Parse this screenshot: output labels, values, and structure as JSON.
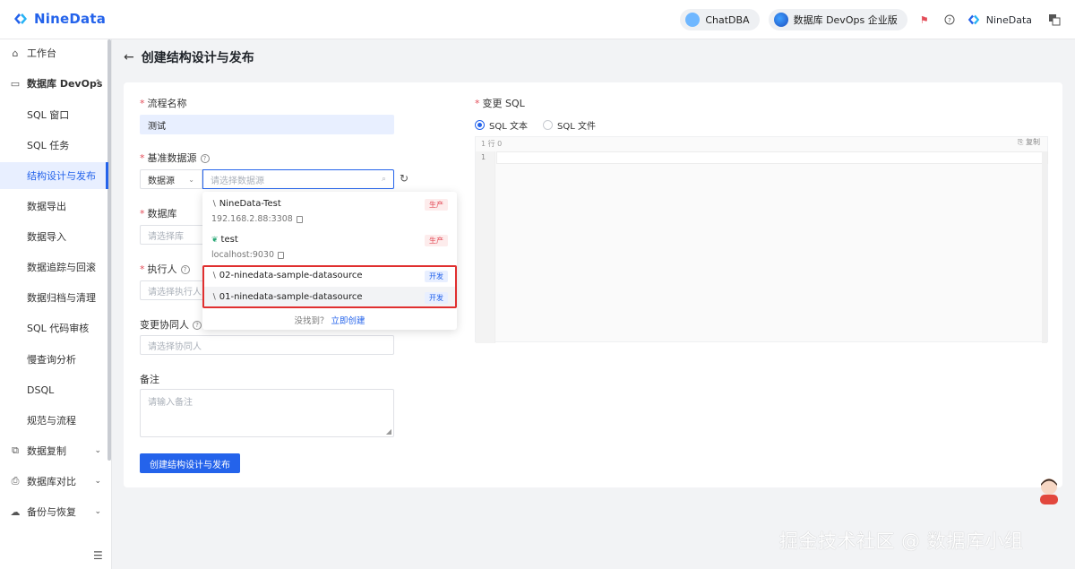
{
  "app": {
    "logo_text": "NineData",
    "chatdba_label": "ChatDBA",
    "edition_label": "数据库 DevOps 企业版",
    "user_name": "NineData"
  },
  "sidebar": {
    "items": [
      {
        "label": "工作台",
        "icon": "home-icon"
      },
      {
        "label": "数据库 DevOps",
        "icon": "monitor-icon",
        "expanded": true
      },
      {
        "label": "SQL 窗口"
      },
      {
        "label": "SQL 任务"
      },
      {
        "label": "结构设计与发布",
        "active": true
      },
      {
        "label": "数据导出"
      },
      {
        "label": "数据导入"
      },
      {
        "label": "数据追踪与回滚"
      },
      {
        "label": "数据归档与清理"
      },
      {
        "label": "SQL 代码审核"
      },
      {
        "label": "慢查询分析"
      },
      {
        "label": "DSQL"
      },
      {
        "label": "规范与流程"
      },
      {
        "label": "数据复制",
        "icon": "copy-icon"
      },
      {
        "label": "数据库对比",
        "icon": "document-icon"
      },
      {
        "label": "备份与恢复",
        "icon": "cloud-icon"
      }
    ]
  },
  "page": {
    "title": "创建结构设计与发布"
  },
  "form": {
    "flow_name_label": "流程名称",
    "flow_name_value": "测试",
    "base_source_label": "基准数据源",
    "source_type_value": "数据源",
    "source_search_placeholder": "请选择数据源",
    "database_label": "数据库",
    "database_placeholder": "请选择库",
    "executor_label": "执行人",
    "executor_placeholder": "请选择执行人",
    "collaborator_label": "变更协同人",
    "collaborator_placeholder": "请选择协同人",
    "remark_label": "备注",
    "remark_placeholder": "请输入备注",
    "submit_label": "创建结构设计与发布"
  },
  "sql_panel": {
    "label": "变更 SQL",
    "option_text": "SQL 文本",
    "option_file": "SQL 文件",
    "selected": "SQL 文本",
    "editor_status": "1 行  0",
    "copy_label": "复制",
    "line_number": "1"
  },
  "dropdown": {
    "items": [
      {
        "name": "NineData-Test",
        "sub": "192.168.2.88:3308",
        "tag": "生产",
        "tag_type": "prod",
        "icon": "mysql-icon"
      },
      {
        "name": "test",
        "sub": "localhost:9030",
        "tag": "生产",
        "tag_type": "prod",
        "icon": "leaf-icon"
      },
      {
        "name": "02-ninedata-sample-datasource",
        "tag": "开发",
        "tag_type": "dev",
        "icon": "mysql-icon"
      },
      {
        "name": "01-ninedata-sample-datasource",
        "tag": "开发",
        "tag_type": "dev",
        "icon": "mysql-icon"
      }
    ],
    "footer_text": "没找到？",
    "footer_link": "立即创建"
  },
  "watermark": "掘金技术社区 @ 数据库小组",
  "colors": {
    "accent": "#2463eb",
    "prod_tag": "#e34d59",
    "highlight_border": "#e02f2f"
  }
}
